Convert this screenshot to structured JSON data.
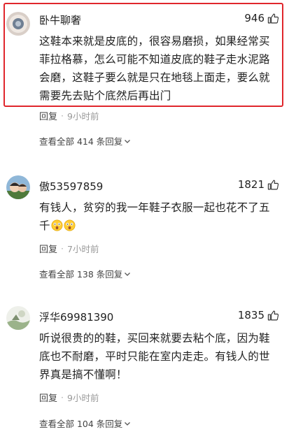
{
  "comments": [
    {
      "username": "卧牛聊奢",
      "likes": "946",
      "text": "这鞋本来就是皮底的，很容易磨损，如果经常买菲拉格慕，怎么可能不知道皮底的鞋子走水泥路会磨，这鞋子要么就是只在地毯上面走，要么就需要先去贴个底然后再出门",
      "reply_label": "回复",
      "separator": "·",
      "time": "9小时前",
      "view_all": "查看全部 414 条回复",
      "highlighted": true
    },
    {
      "username": "傲53597859",
      "likes": "1821",
      "text": "有钱人，贫穷的我一年鞋子衣服一起也花不了五千",
      "reply_label": "回复",
      "separator": "·",
      "time": "7小时前",
      "view_all": "查看全部 138 条回复",
      "emoji": [
        "surprised-emoji",
        "surprised-emoji"
      ]
    },
    {
      "username": "浮华69981390",
      "likes": "1835",
      "text": "听说很贵的的鞋，买回来就要去粘个底，因为鞋底也不耐磨，平时只能在室内走走。有钱人的世界真是搞不懂啊！",
      "reply_label": "回复",
      "separator": "·",
      "time": "9小时前",
      "view_all": "查看全部 104 条回复"
    }
  ],
  "colors": {
    "highlight_border": "#e0262c",
    "meta_gray": "#999999",
    "text": "#222222"
  },
  "icons": [
    "like-thumb-icon",
    "chevron-down-icon",
    "avatar"
  ]
}
